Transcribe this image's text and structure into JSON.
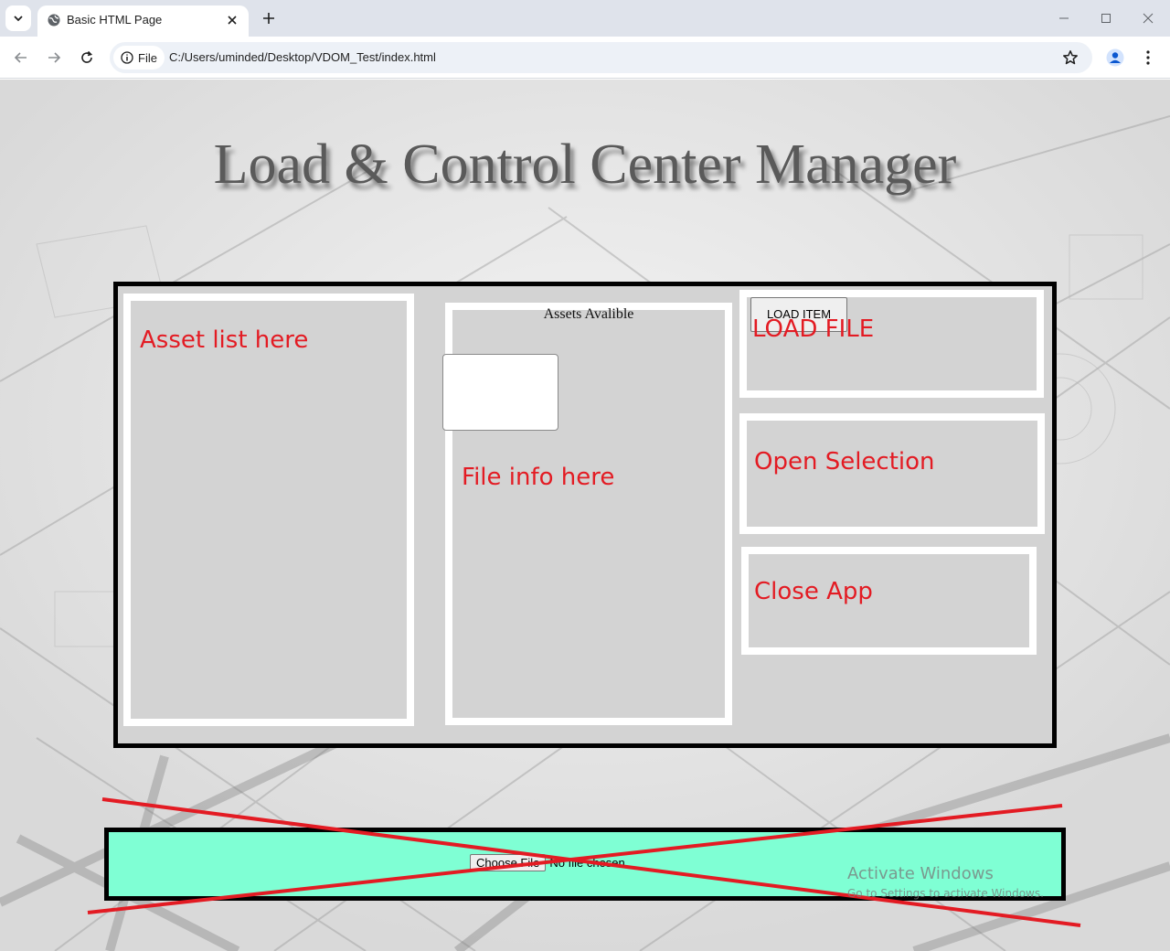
{
  "browser": {
    "tab_title": "Basic HTML Page",
    "site_chip_label": "File",
    "url": "C:/Users/uminded/Desktop/VDOM_Test/index.html",
    "icons": {
      "tab_list": "chevron-down-icon",
      "favicon": "globe-icon",
      "tab_close": "close-icon",
      "new_tab": "plus-icon",
      "minimize": "minimize-icon",
      "maximize": "maximize-icon",
      "close_window": "close-icon",
      "back": "arrow-left-icon",
      "forward": "arrow-right-icon",
      "reload": "reload-icon",
      "site_info": "info-icon",
      "bookmark": "star-icon",
      "profile": "person-icon",
      "menu": "kebab-menu-icon"
    }
  },
  "page": {
    "title": "Load & Control Center Manager",
    "asset_list": {
      "label": "Asset list here"
    },
    "file_info": {
      "heading": "Assets Avalible",
      "label": "File info here"
    },
    "load_file": {
      "button_label": "LOAD ITEM",
      "label": "LOAD FILE"
    },
    "open_selection": {
      "label": "Open Selection"
    },
    "close_app": {
      "label": "Close App"
    },
    "file_input": {
      "button_label": "Choose File",
      "status": "No file chosen"
    }
  },
  "watermark": {
    "line1": "Activate Windows",
    "line2": "Go to Settings to activate Windows."
  },
  "colors": {
    "panel_bg": "#d3d3d3",
    "label_red": "#e31b23",
    "file_bar_bg": "#7fffd4",
    "cross_red": "#e31b23"
  }
}
